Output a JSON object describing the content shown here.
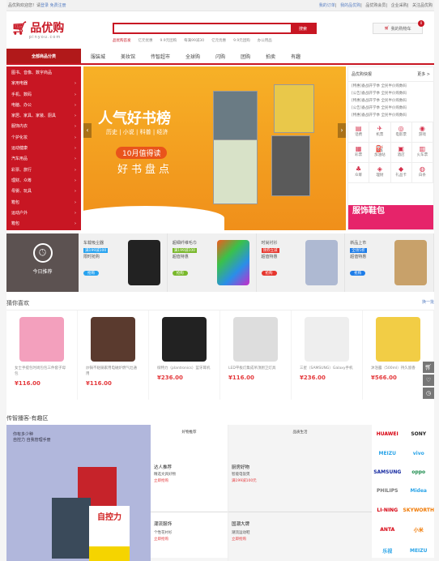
{
  "topbar": {
    "welcome": "品优购欢迎您！请",
    "login": "登录",
    "register": "免费注册",
    "links": [
      "我的订单",
      "我的品优购",
      "品优购会员",
      "企业采购",
      "关注品优购"
    ]
  },
  "logo": {
    "name": "品优购",
    "domain": "pinyou.com"
  },
  "search": {
    "placeholder": "",
    "button": "搜索",
    "hot": [
      "品优购首发",
      "亿元优惠",
      "9.9元团购",
      "每满99减30",
      "亿元优惠",
      "9.9元团购",
      "办公用品"
    ]
  },
  "cart": {
    "label": "我的购物车",
    "count": "0"
  },
  "nav": {
    "all": "全部商品分类",
    "items": [
      "服装城",
      "美妆馆",
      "传智超市",
      "全球购",
      "闪购",
      "团购",
      "拍卖",
      "有趣"
    ]
  },
  "categories": [
    "图书、音像、数字商品",
    "家用电器",
    "手机、数码",
    "电脑、办公",
    "家居、家具、家装、厨具",
    "服饰内衣",
    "个护化妆",
    "运动健康",
    "汽车用品",
    "彩票、旅行",
    "理财、众筹",
    "母婴、玩具",
    "箱包",
    "运动户外",
    "箱包"
  ],
  "banner": {
    "title": "人气好书榜",
    "subtitle": "历史 | 小说 | 科普 | 经济",
    "tag": "10月值得读",
    "slogan": "好书盘点"
  },
  "news": {
    "title": "品优购快报",
    "more": "更多 >",
    "items": [
      "[特惠]备战开学季 全民半价购数码",
      "[公告]备战开学季 全民半价购数码",
      "[特惠]备战开学季 全民半价购数码",
      "[公告]备战开学季 全民半价购数码",
      "[特惠]备战开学季 全民半价购数码"
    ],
    "services": [
      {
        "icon": "▤",
        "label": "话费"
      },
      {
        "icon": "✈",
        "label": "机票"
      },
      {
        "icon": "◎",
        "label": "电影票"
      },
      {
        "icon": "◉",
        "label": "游戏"
      },
      {
        "icon": "▦",
        "label": "彩票"
      },
      {
        "icon": "⛽",
        "label": "加油站"
      },
      {
        "icon": "▣",
        "label": "酒店"
      },
      {
        "icon": "▥",
        "label": "火车票"
      },
      {
        "icon": "♣",
        "label": "众筹"
      },
      {
        "icon": "◈",
        "label": "理财"
      },
      {
        "icon": "◆",
        "label": "礼品卡"
      },
      {
        "icon": "◍",
        "label": "白条"
      }
    ],
    "ad": "服饰鞋包"
  },
  "today": {
    "title": "今日推荐",
    "items": [
      {
        "name": "车载吸尘器",
        "tag": "满199减100",
        "desc": "限时抢购",
        "btn": "抢购",
        "color": "#28a3ef"
      },
      {
        "name": "超细纤维毛巾",
        "tag": "满199减100",
        "desc": "超值特惠",
        "btn": "抢购",
        "color": "#79b82c"
      },
      {
        "name": "时尚衬衫",
        "tag": "领券立减",
        "desc": "超值特惠",
        "btn": "抢购",
        "color": "#e6362e"
      },
      {
        "name": "新品上市",
        "tag": "全场5折",
        "desc": "超值特惠",
        "btn": "抢购",
        "color": "#1e7de8"
      }
    ]
  },
  "guess": {
    "title": "猜你喜欢",
    "refresh": "换一批",
    "items": [
      {
        "desc": "女士手提包时尚包包三件套子母包",
        "price": "¥116.00"
      },
      {
        "desc": "炒锅不粘锅家用电磁炉燃气灶通用",
        "price": "¥116.00"
      },
      {
        "desc": "缤特力（plantronics）蓝牙耳机",
        "price": "¥236.00"
      },
      {
        "desc": "LED平板灯集成吊顶厨卫灯具",
        "price": "¥116.00"
      },
      {
        "desc": "三星（SAMSUNG）Galaxy手机",
        "price": "¥236.00"
      },
      {
        "desc": "沐浴露（500ml）持久留香",
        "price": "¥566.00"
      }
    ]
  },
  "fun": {
    "title": "传智播客-有趣区",
    "feature": [
      "你有多少种",
      "自控力 自我管理手册"
    ],
    "book": "自控力",
    "cells": [
      {
        "top": "好物推荐",
        "name": "达人推荐",
        "sub": "精选文具好物",
        "red": "立即抢购"
      },
      {
        "top": "品质生活",
        "name": "厨房好物",
        "sub": "智能电饭煲",
        "red": "满199减100元"
      },
      {
        "top": "",
        "name": "潮流服饰",
        "sub": "个性花衬衫",
        "red": "立即抢购"
      },
      {
        "top": "",
        "name": "国潮大牌",
        "sub": "潮流运动鞋",
        "red": "立即抢购"
      }
    ],
    "brands": [
      {
        "t": "HUAWEI",
        "c": "#d7000f"
      },
      {
        "t": "SONY",
        "c": "#222"
      },
      {
        "t": "MEIZU",
        "c": "#2aa4e8"
      },
      {
        "t": "vivo",
        "c": "#2aa4e8"
      },
      {
        "t": "SAMSUNG",
        "c": "#1428a0"
      },
      {
        "t": "oppo",
        "c": "#1c8c4d"
      },
      {
        "t": "PHILIPS",
        "c": "#777"
      },
      {
        "t": "Midea",
        "c": "#2aa4e8"
      },
      {
        "t": "LI-NING",
        "c": "#d7000f"
      },
      {
        "t": "SKYWORTH",
        "c": "#f07800"
      },
      {
        "t": "ANTA",
        "c": "#d7000f"
      },
      {
        "t": "小米",
        "c": "#f07800"
      },
      {
        "t": "乐视",
        "c": "#2aa4e8"
      },
      {
        "t": "MEIZU",
        "c": "#2aa4e8"
      }
    ]
  }
}
